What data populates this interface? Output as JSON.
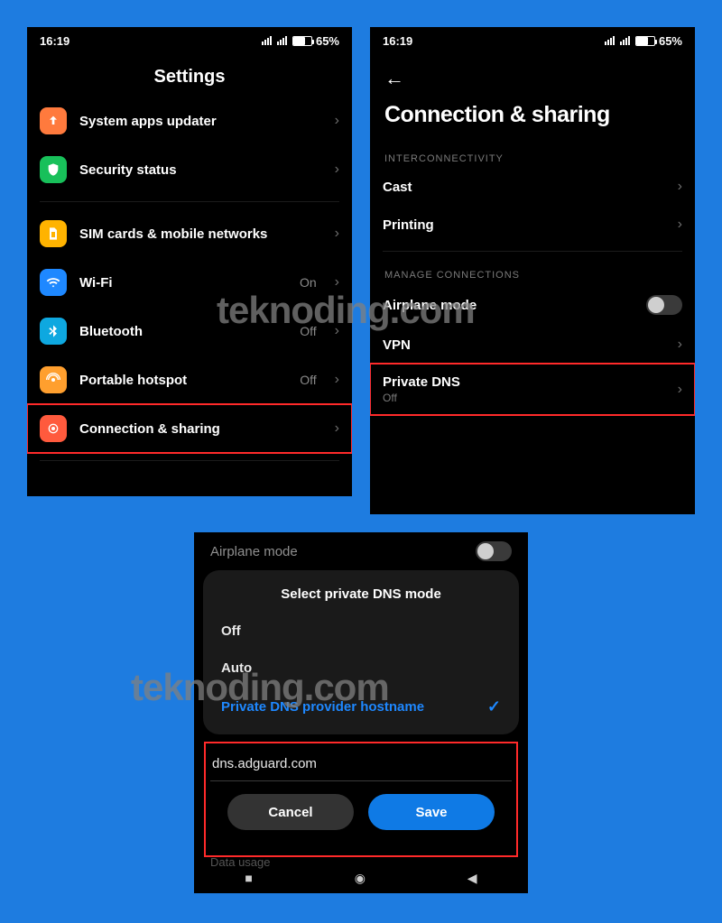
{
  "watermark": "teknoding.com",
  "status": {
    "time": "16:19",
    "battery_pct": "65%"
  },
  "screen1": {
    "title": "Settings",
    "rows": [
      {
        "label": "System apps updater",
        "icon": "arrow-up-icon",
        "icon_color": "ic-orange"
      },
      {
        "label": "Security status",
        "icon": "shield-icon",
        "icon_color": "ic-green"
      }
    ],
    "rows2": [
      {
        "label": "SIM cards & mobile networks",
        "icon": "sim-icon",
        "icon_color": "ic-yellow"
      },
      {
        "label": "Wi-Fi",
        "value": "On",
        "icon": "wifi-icon",
        "icon_color": "ic-blue"
      },
      {
        "label": "Bluetooth",
        "value": "Off",
        "icon": "bluetooth-icon",
        "icon_color": "ic-teal"
      },
      {
        "label": "Portable hotspot",
        "value": "Off",
        "icon": "hotspot-icon",
        "icon_color": "ic-amber"
      },
      {
        "label": "Connection & sharing",
        "icon": "share-icon",
        "icon_color": "ic-red",
        "highlight": true
      }
    ]
  },
  "screen2": {
    "title": "Connection & sharing",
    "section1_label": "INTERCONNECTIVITY",
    "section1": [
      {
        "label": "Cast"
      },
      {
        "label": "Printing"
      }
    ],
    "section2_label": "MANAGE CONNECTIONS",
    "section2": [
      {
        "label": "Airplane mode",
        "toggle": true
      },
      {
        "label": "VPN"
      },
      {
        "label": "Private DNS",
        "sub": "Off",
        "highlight": true
      }
    ]
  },
  "screen3": {
    "dim_row_label": "Airplane mode",
    "sheet_title": "Select private DNS mode",
    "options": [
      {
        "label": "Off",
        "selected": false
      },
      {
        "label": "Auto",
        "selected": false
      },
      {
        "label": "Private DNS provider hostname",
        "selected": true
      }
    ],
    "input_value": "dns.adguard.com",
    "cancel": "Cancel",
    "save": "Save",
    "bottom_cut_label": "Data usage"
  }
}
